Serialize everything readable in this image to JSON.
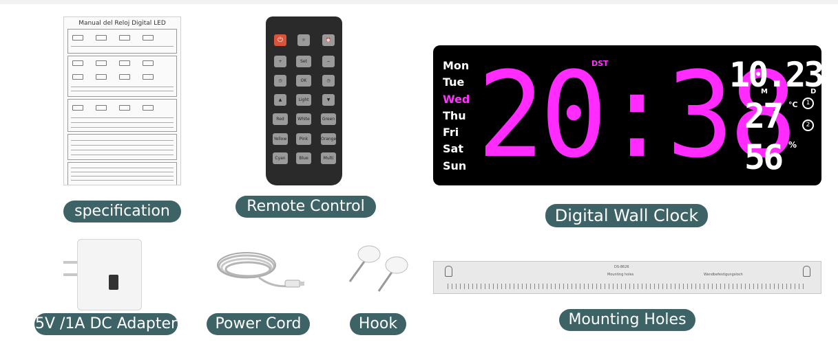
{
  "labels": {
    "specification": "specification",
    "remote": "Remote Control",
    "clock": "Digital Wall Clock",
    "adapter": "5V /1A DC Adapter",
    "cord": "Power Cord",
    "hook": "Hook",
    "mounting": "Mounting Holes"
  },
  "manual": {
    "title": "Manual del Reloj Digital LED"
  },
  "remote": {
    "buttons": [
      {
        "label": "⏻",
        "icon": "power-icon"
      },
      {
        "label": "☼",
        "icon": "brightness-icon"
      },
      {
        "label": "⏰",
        "icon": "alarm-icon"
      },
      {
        "label": "+",
        "icon": "plus-icon"
      },
      {
        "label": "Set"
      },
      {
        "label": "−",
        "icon": "minus-icon"
      },
      {
        "label": "◷",
        "icon": "timer-icon"
      },
      {
        "label": "OK"
      },
      {
        "label": "◷",
        "icon": "clock-icon"
      },
      {
        "label": "▲",
        "icon": "up-icon"
      },
      {
        "label": "Light"
      },
      {
        "label": "▼",
        "icon": "down-icon"
      },
      {
        "label": "Red"
      },
      {
        "label": "White"
      },
      {
        "label": "Green"
      },
      {
        "label": "Yellow"
      },
      {
        "label": "Pink"
      },
      {
        "label": "Orange"
      },
      {
        "label": "Cyan"
      },
      {
        "label": "Blue"
      },
      {
        "label": "Multi"
      }
    ]
  },
  "clock": {
    "days": [
      "Mon",
      "Tue",
      "Wed",
      "Thu",
      "Fri",
      "Sat",
      "Sun"
    ],
    "active_day": "Wed",
    "time": "20:38",
    "dst": "DST",
    "date": "10.23",
    "month_label": "M",
    "day_label": "D",
    "temperature": "27",
    "temp_unit": "°C",
    "humidity": "56",
    "humidity_unit": "%",
    "alarm1": "1",
    "alarm2": "2",
    "accent": "#ff2bff"
  },
  "ruler": {
    "text_center_top": "DS-8626",
    "text_center": "Mounting holes",
    "text_right": "Wandbefestigungsloch"
  },
  "colors": {
    "pill": "#3d6366"
  }
}
